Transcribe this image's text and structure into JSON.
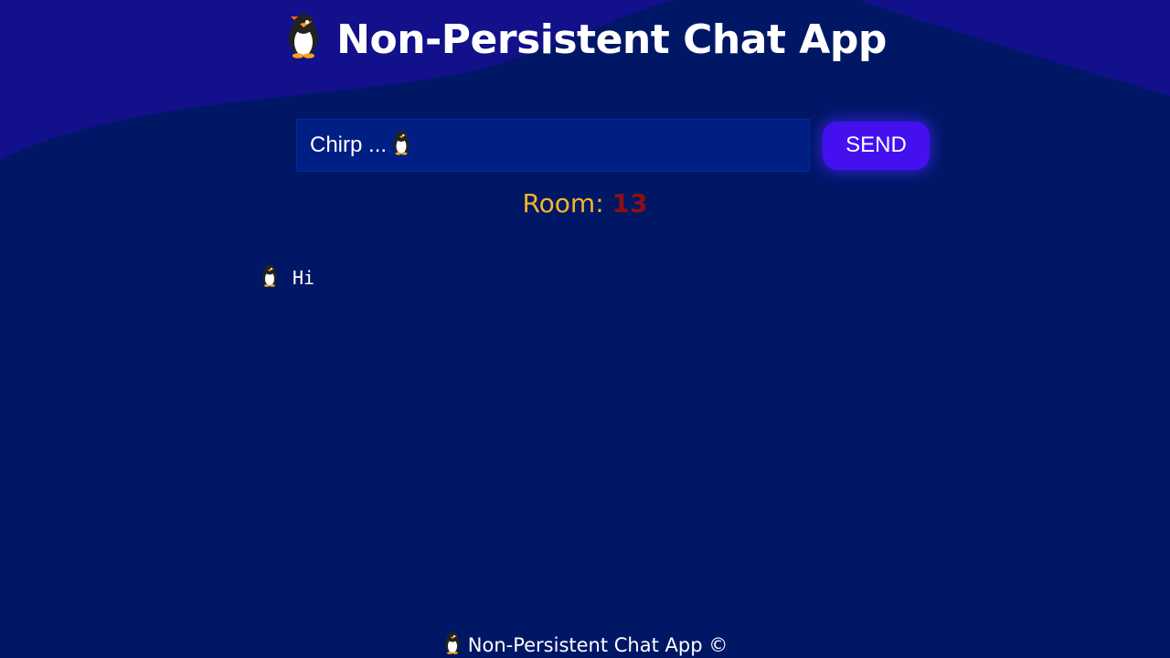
{
  "app": {
    "title": "Non-Persistent Chat App"
  },
  "composer": {
    "placeholder": "Chirp ...",
    "send_label": "SEND"
  },
  "room": {
    "label": "Room:",
    "number": "13"
  },
  "messages": [
    {
      "icon": "penguin-icon",
      "text": "Hi"
    }
  ],
  "footer": {
    "text": "Non-Persistent Chat App ©"
  },
  "colors": {
    "background": "#001766",
    "wave": "#12108a",
    "input_bg": "#001f84",
    "send_button": "#4410f0",
    "room_label": "#f3b52a",
    "room_number": "#8d0f14"
  }
}
